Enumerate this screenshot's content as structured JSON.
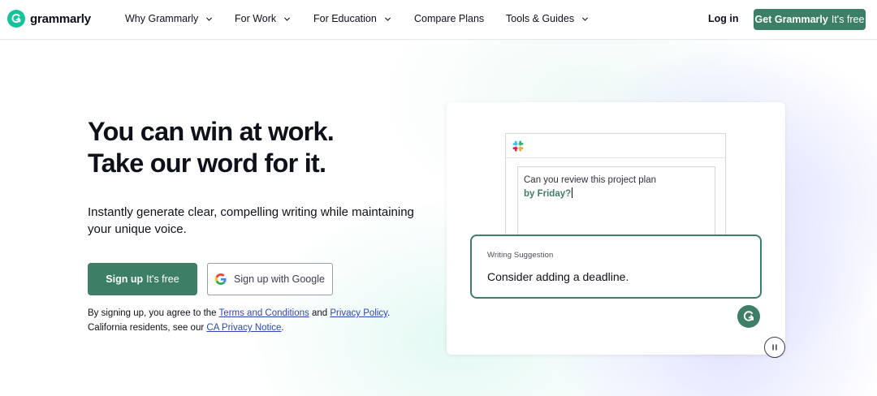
{
  "header": {
    "logo_text": "grammarly",
    "nav": [
      {
        "label": "Why Grammarly",
        "has_dropdown": true
      },
      {
        "label": "For Work",
        "has_dropdown": true
      },
      {
        "label": "For Education",
        "has_dropdown": true
      },
      {
        "label": "Compare Plans",
        "has_dropdown": false
      },
      {
        "label": "Tools & Guides",
        "has_dropdown": true
      }
    ],
    "login_label": "Log in",
    "cta_bold": "Get Grammarly",
    "cta_rest": "It's free"
  },
  "hero": {
    "headline_line1": "You can win at work.",
    "headline_line2": "Take our word for it.",
    "subtext": "Instantly generate clear, compelling writing while maintaining your unique voice.",
    "signup_bold": "Sign up",
    "signup_rest": "It's free",
    "google_label": "Sign up with Google",
    "legal": {
      "part1": "By signing up, you agree to the ",
      "terms_link": "Terms and Conditions",
      "part2": " and ",
      "privacy_link": "Privacy Policy",
      "part3": ".",
      "part4": "California residents, see our ",
      "ca_link": "CA Privacy Notice",
      "part5": "."
    }
  },
  "demo": {
    "message_line1": "Can you review this project plan",
    "message_highlight": "by Friday?",
    "suggestion_label": "Writing Suggestion",
    "suggestion_text": "Consider adding a deadline."
  },
  "icons": {
    "logo": "grammarly-logo-icon",
    "google": "google-icon",
    "slack": "slack-icon",
    "fab": "grammarly-g-icon",
    "pause": "pause-icon"
  },
  "colors": {
    "brand_green": "#3c7f66",
    "logo_green": "#15c39a",
    "link_blue": "#2b47b5"
  }
}
